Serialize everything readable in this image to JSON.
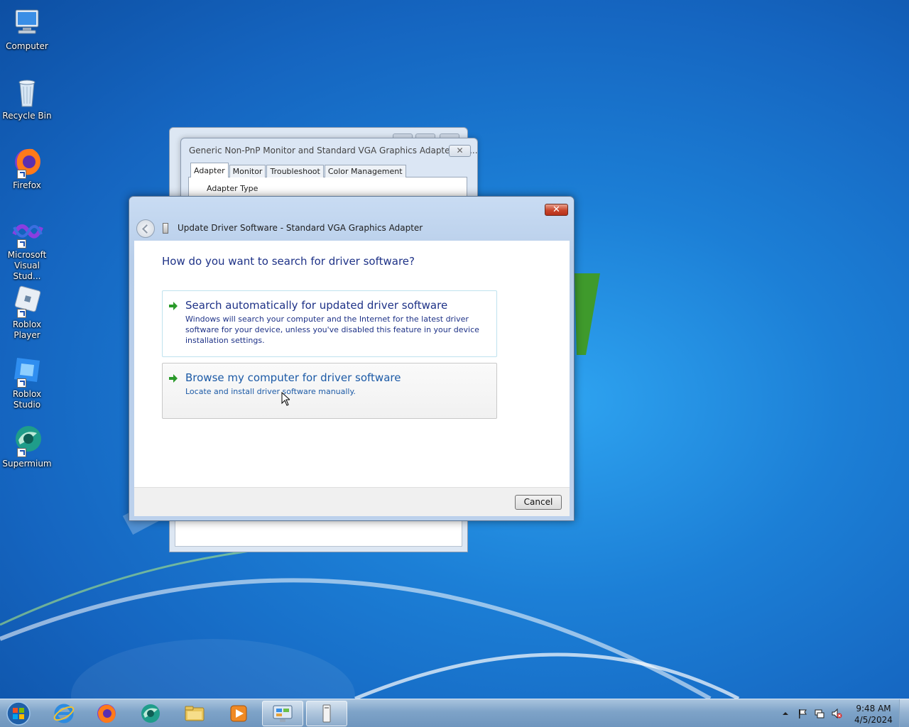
{
  "desktop": {
    "icons": [
      {
        "label": "Computer"
      },
      {
        "label": "Recycle Bin"
      },
      {
        "label": "Firefox"
      },
      {
        "label": "Microsoft Visual Stud..."
      },
      {
        "label": "Roblox Player"
      },
      {
        "label": "Roblox Studio"
      },
      {
        "label": "Supermium"
      }
    ]
  },
  "properties_window": {
    "title": "Generic Non-PnP Monitor and Standard VGA Graphics Adapter Pro...",
    "close_label": "✕",
    "tabs": [
      "Adapter",
      "Monitor",
      "Troubleshoot",
      "Color Management"
    ],
    "group_label": "Adapter Type"
  },
  "wizard": {
    "title": "Update Driver Software - Standard VGA Graphics Adapter",
    "close_label": "✕",
    "question": "How do you want to search for driver software?",
    "options": [
      {
        "title": "Search automatically for updated driver software",
        "description": "Windows will search your computer and the Internet for the latest driver software for your device, unless you've disabled this feature in your device installation settings."
      },
      {
        "title": "Browse my computer for driver software",
        "description": "Locate and install driver software manually."
      }
    ],
    "cancel_label": "Cancel"
  },
  "taskbar": {
    "apps": [
      "start-orb",
      "internet-explorer-icon",
      "firefox-icon",
      "supermium-icon",
      "file-explorer-icon",
      "media-player-icon",
      "control-panel-icon",
      "device-icon"
    ],
    "clock_time": "9:48 AM",
    "clock_date": "4/5/2024"
  },
  "colors": {
    "link_blue": "#1e3287",
    "accent_green": "#2a9a2a",
    "close_red": "#c8452a"
  }
}
